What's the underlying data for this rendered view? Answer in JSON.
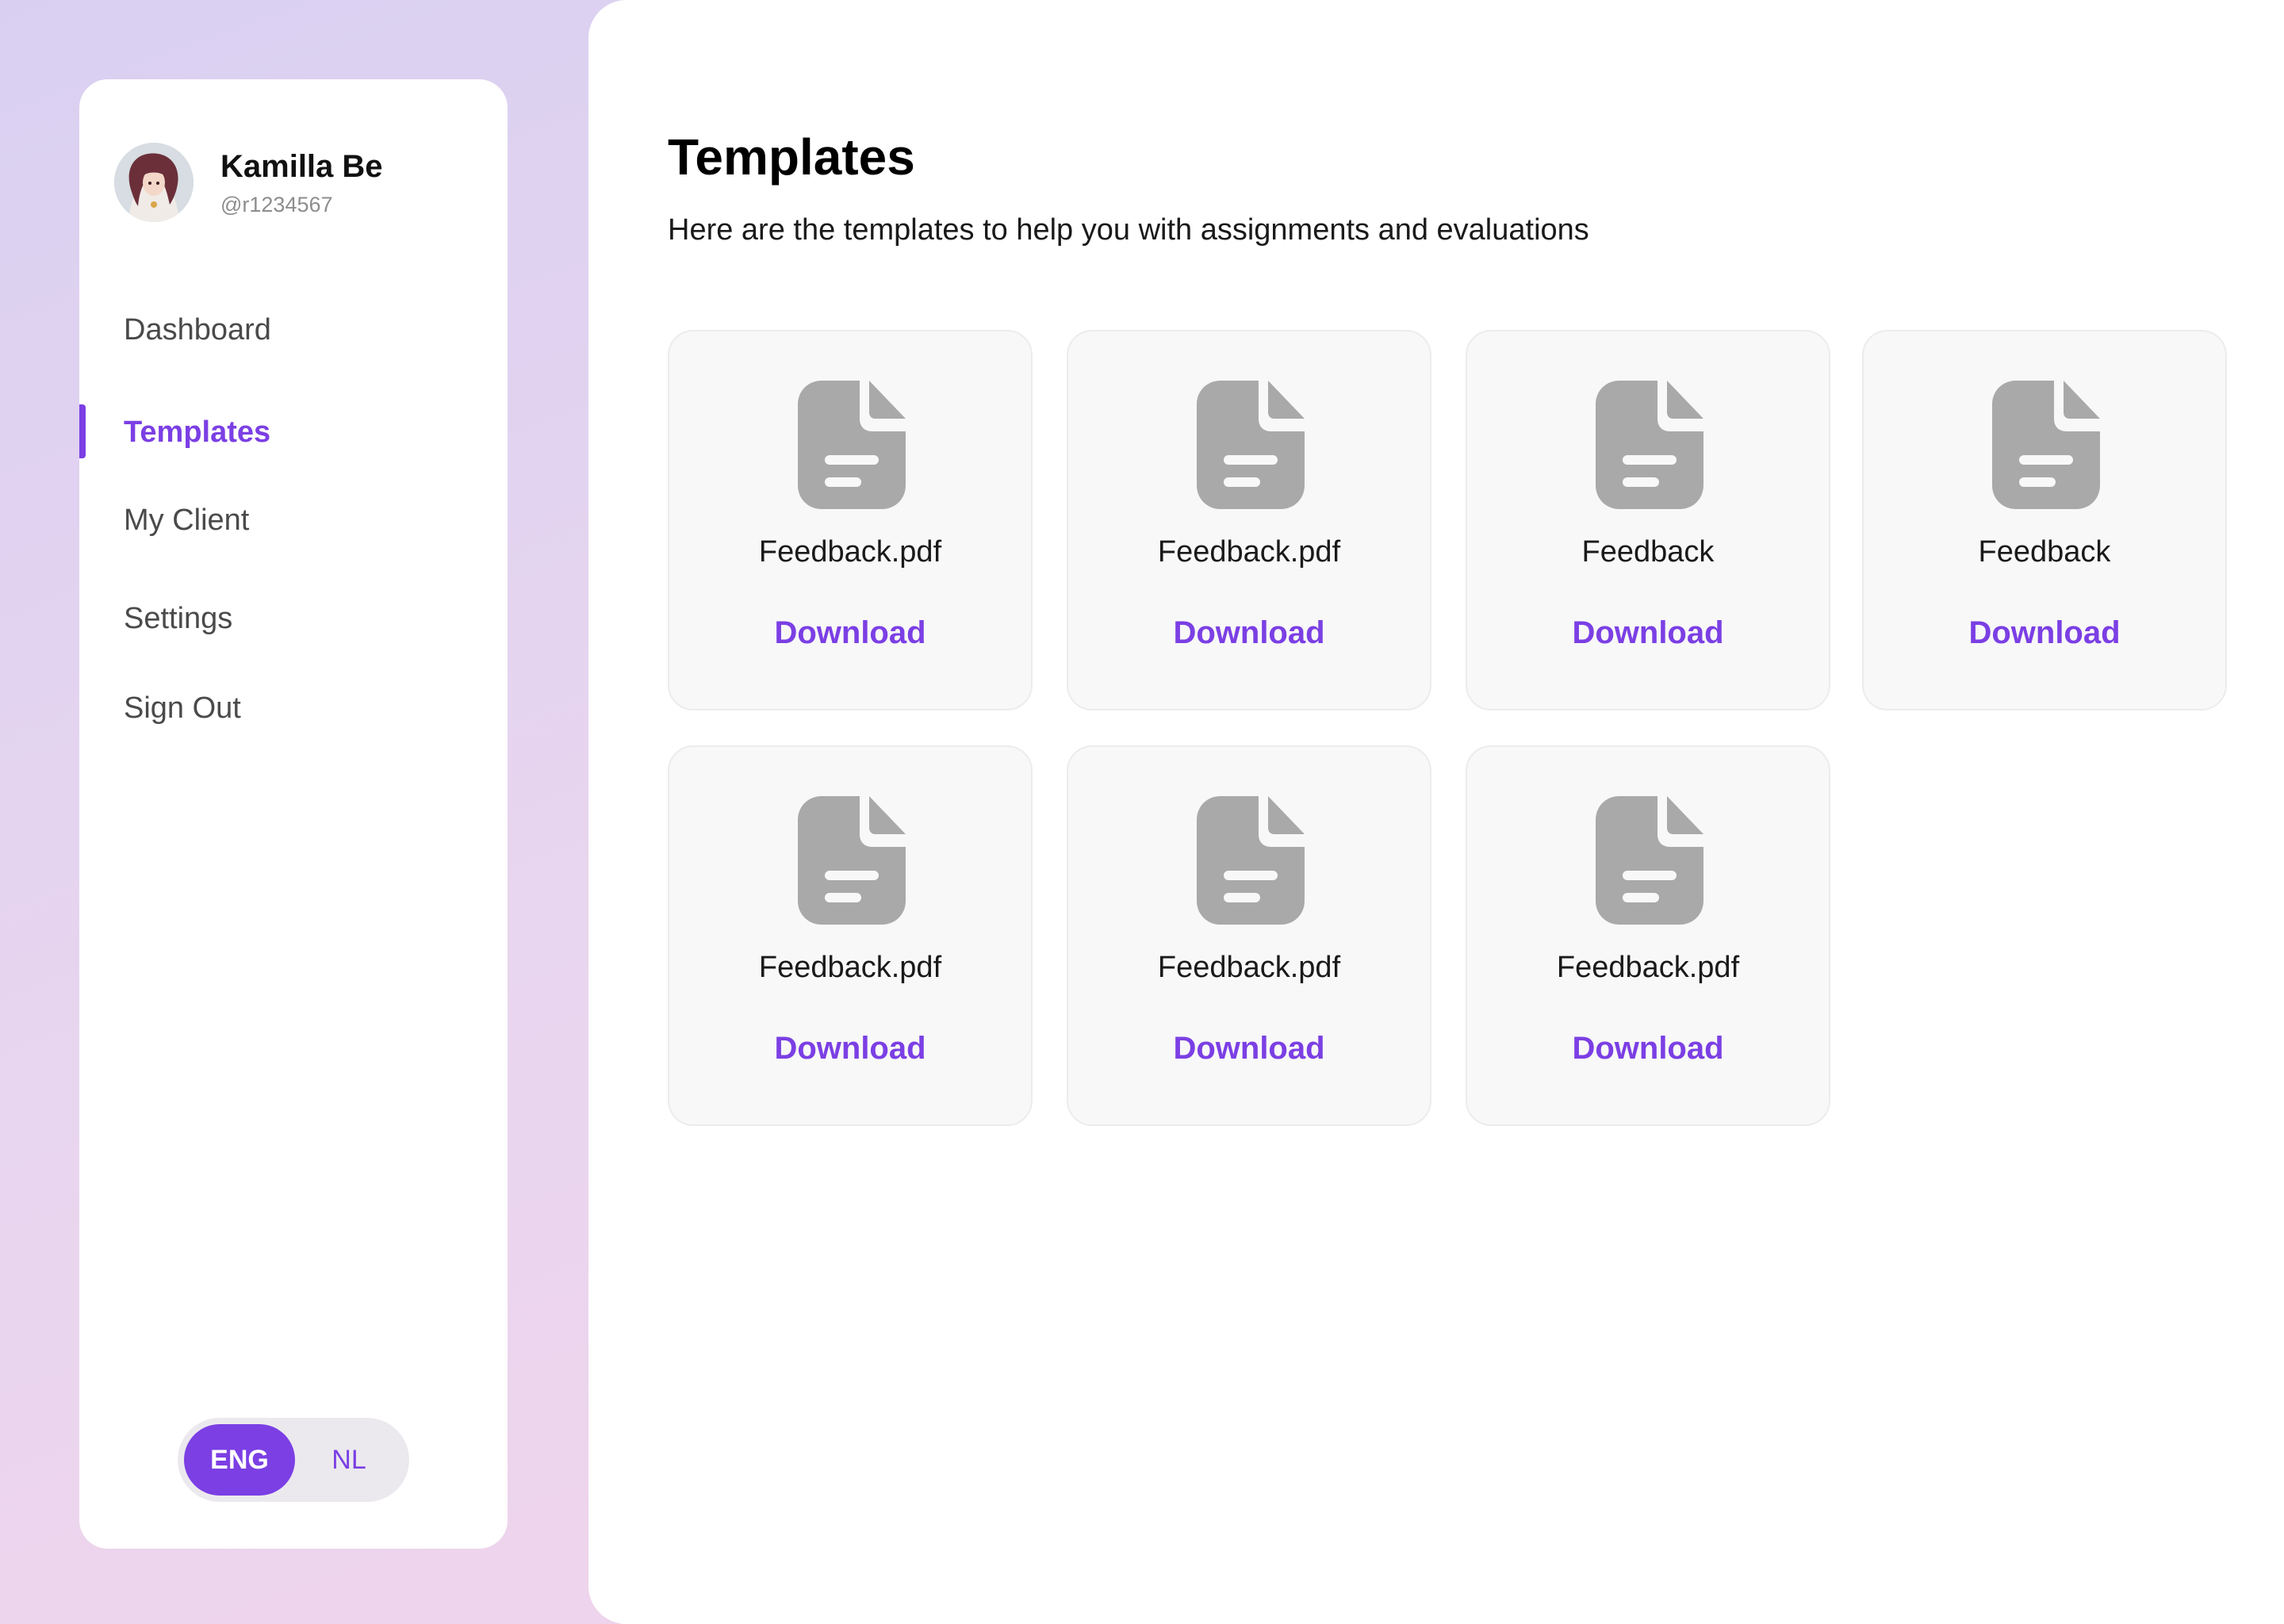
{
  "profile": {
    "name": "Kamilla Be",
    "handle": "@r1234567"
  },
  "nav": {
    "items": [
      {
        "label": "Dashboard",
        "active": false
      },
      {
        "label": "Templates",
        "active": true
      },
      {
        "label": "My Client",
        "active": false
      },
      {
        "label": "Settings",
        "active": false
      },
      {
        "label": "Sign Out",
        "active": false
      }
    ]
  },
  "language": {
    "options": [
      "ENG",
      "NL"
    ],
    "selected": "ENG"
  },
  "main": {
    "title": "Templates",
    "subtitle": "Here are the templates to help you with assignments and evaluations"
  },
  "templates": [
    {
      "name": "Feedback.pdf",
      "action": "Download",
      "icon": "file-icon"
    },
    {
      "name": "Feedback.pdf",
      "action": "Download",
      "icon": "file-icon"
    },
    {
      "name": "Feedback",
      "action": "Download",
      "icon": "file-icon"
    },
    {
      "name": "Feedback",
      "action": "Download",
      "icon": "file-icon"
    },
    {
      "name": "Feedback.pdf",
      "action": "Download",
      "icon": "file-icon"
    },
    {
      "name": "Feedback.pdf",
      "action": "Download",
      "icon": "file-icon"
    },
    {
      "name": "Feedback.pdf",
      "action": "Download",
      "icon": "file-icon"
    }
  ],
  "colors": {
    "accent": "#7b3fe4",
    "icon": "#a9a9a9",
    "card": "#f8f8f8"
  }
}
